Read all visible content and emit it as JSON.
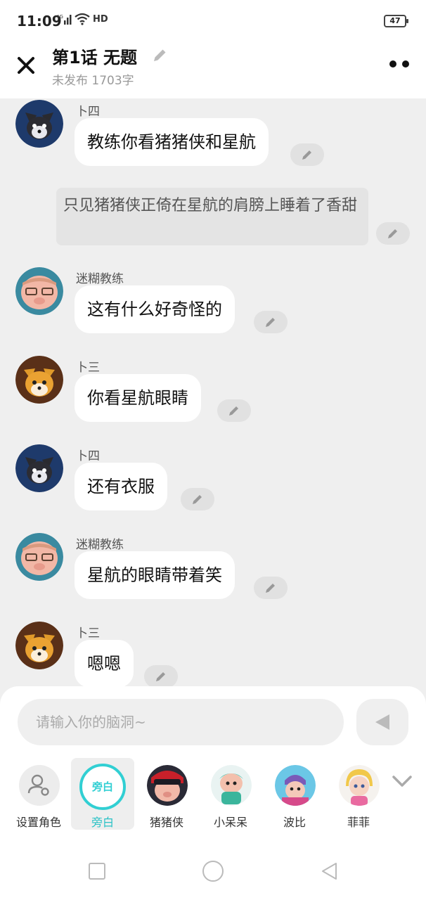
{
  "status_bar": {
    "time": "11:09",
    "network": "4G",
    "wifi": "HD",
    "battery": "47"
  },
  "header": {
    "title": "第1话  无题",
    "subtitle": "未发布 1703字"
  },
  "messages": [
    {
      "type": "role",
      "name": "卜四",
      "text": "教练你看猪猪侠和星航",
      "avatar": "wolf-avatar"
    },
    {
      "type": "narration",
      "text": "只见猪猪侠正倚在星航的肩膀上睡着了香甜"
    },
    {
      "type": "role",
      "name": "迷糊教练",
      "text": "这有什么好奇怪的",
      "avatar": "pig-coach-avatar"
    },
    {
      "type": "role",
      "name": "卜三",
      "text": "你看星航眼睛",
      "avatar": "fox-avatar"
    },
    {
      "type": "role",
      "name": "卜四",
      "text": "还有衣服",
      "avatar": "wolf-avatar"
    },
    {
      "type": "role",
      "name": "迷糊教练",
      "text": "星航的眼睛带着笑",
      "avatar": "pig-coach-avatar"
    },
    {
      "type": "role",
      "name": "卜三",
      "text": "嗯嗯",
      "avatar": "fox-avatar"
    }
  ],
  "input": {
    "placeholder": "请输入你的脑洞~"
  },
  "roles": [
    {
      "label": "设置角色",
      "icon": "user-settings-icon"
    },
    {
      "label": "旁白",
      "badge": "旁白",
      "selected": true
    },
    {
      "label": "猪猪侠",
      "avatar": "gg-bond-avatar"
    },
    {
      "label": "小呆呆",
      "avatar": "xiaodaidai-avatar"
    },
    {
      "label": "波比",
      "avatar": "bobi-avatar"
    },
    {
      "label": "菲菲",
      "avatar": "feifei-avatar"
    }
  ],
  "colors": {
    "accent": "#31cfd3",
    "bubble": "#ffffff",
    "background": "#efefef",
    "narration": "#e4e4e4"
  }
}
